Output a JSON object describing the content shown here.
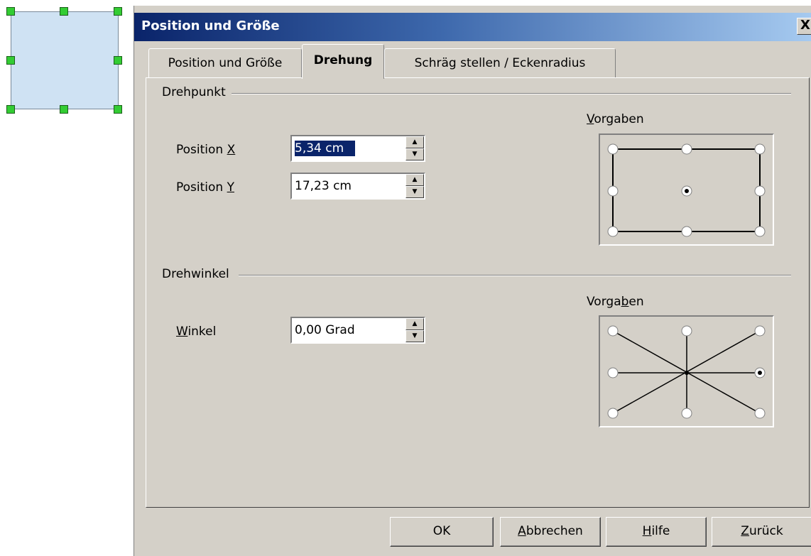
{
  "dialog": {
    "title": "Position und Größe",
    "close_glyph": "X",
    "tabs": [
      {
        "label": "Position und Größe",
        "active": false
      },
      {
        "label": "Drehung",
        "active": true
      },
      {
        "label": "Schräg stellen / Eckenradius",
        "active": false
      }
    ]
  },
  "pivot": {
    "heading": "Drehpunkt",
    "position_x": {
      "label": "Position X",
      "value": "5,34 cm"
    },
    "position_y": {
      "label": "Position Y",
      "value": "17,23 cm"
    },
    "presets_label": "Vorgaben",
    "selected_preset": "center"
  },
  "angle": {
    "heading": "Drehwinkel",
    "angle_field": {
      "label": "Winkel",
      "value": "0,00 Grad"
    },
    "presets_label": "Vorgaben",
    "selected_preset": "right"
  },
  "buttons": {
    "ok": "OK",
    "cancel": "Abbrechen",
    "help": "Hilfe",
    "reset": "Zurück"
  },
  "colors": {
    "title_gradient_start": "#0a246a",
    "title_gradient_end": "#a6caf0",
    "dialog_face": "#d4d0c8",
    "shape_fill": "#cfe2f3",
    "handle_green": "#33cc33"
  }
}
